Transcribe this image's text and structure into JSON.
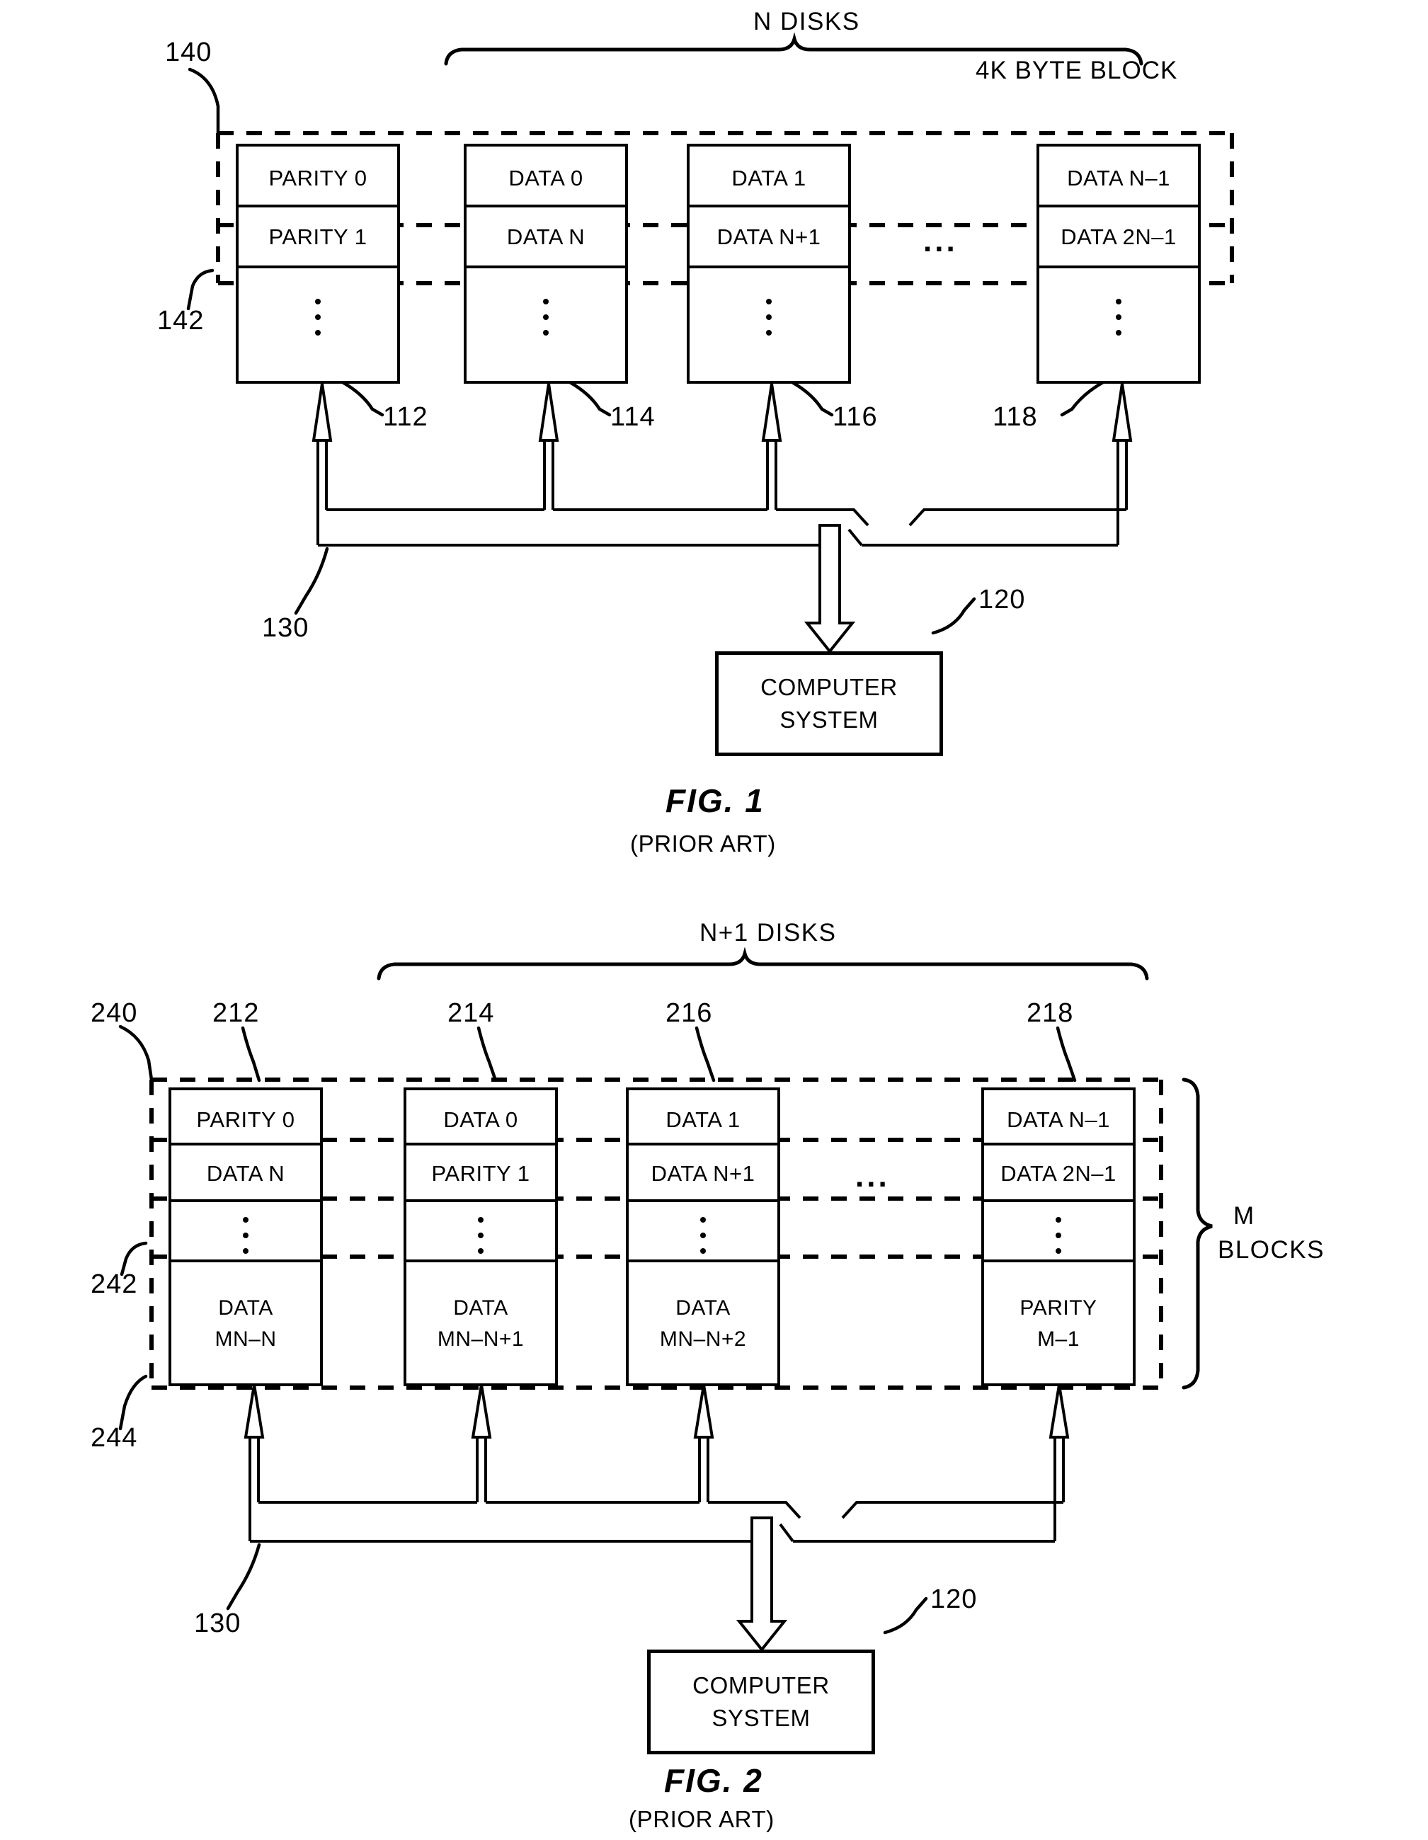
{
  "figures": [
    {
      "id": "fig1",
      "title": "FIG. 1",
      "subtitle": "(PRIOR ART)",
      "brace_label": "N DISKS",
      "block_label": "4K BYTE BLOCK",
      "refs": {
        "outer_array": "140",
        "stripe": "142",
        "bus": "130",
        "computer": "120",
        "disk1": "112",
        "disk2": "114",
        "disk3": "116",
        "diskN": "118"
      },
      "ellipsis": "...",
      "computer_system": {
        "line1": "COMPUTER",
        "line2": "SYSTEM"
      },
      "disks": [
        {
          "ref": "112",
          "cells": [
            "PARITY 0",
            "PARITY 1",
            "⋮"
          ]
        },
        {
          "ref": "114",
          "cells": [
            "DATA 0",
            "DATA N",
            "⋮"
          ]
        },
        {
          "ref": "116",
          "cells": [
            "DATA 1",
            "DATA N+1",
            "⋮"
          ]
        },
        {
          "ref": "118",
          "cells": [
            "DATA N–1",
            "DATA 2N–1",
            "⋮"
          ]
        }
      ]
    },
    {
      "id": "fig2",
      "title": "FIG. 2",
      "subtitle": "(PRIOR ART)",
      "brace_label": "N+1 DISKS",
      "blocks_label_line1": "M",
      "blocks_label_line2": "BLOCKS",
      "refs": {
        "outer_array": "240",
        "stripe": "242",
        "last_stripe": "244",
        "bus": "130",
        "computer": "120",
        "disk1": "212",
        "disk2": "214",
        "disk3": "216",
        "diskN": "218"
      },
      "ellipsis": "...",
      "computer_system": {
        "line1": "COMPUTER",
        "line2": "SYSTEM"
      },
      "disks": [
        {
          "ref": "212",
          "cells": [
            "PARITY 0",
            "DATA N",
            "⋮",
            "DATA",
            "MN–N"
          ]
        },
        {
          "ref": "214",
          "cells": [
            "DATA 0",
            "PARITY 1",
            "⋮",
            "DATA",
            "MN–N+1"
          ]
        },
        {
          "ref": "216",
          "cells": [
            "DATA 1",
            "DATA N+1",
            "⋮",
            "DATA",
            "MN–N+2"
          ]
        },
        {
          "ref": "218",
          "cells": [
            "DATA N–1",
            "DATA 2N–1",
            "⋮",
            "PARITY",
            "M–1"
          ]
        }
      ]
    }
  ]
}
